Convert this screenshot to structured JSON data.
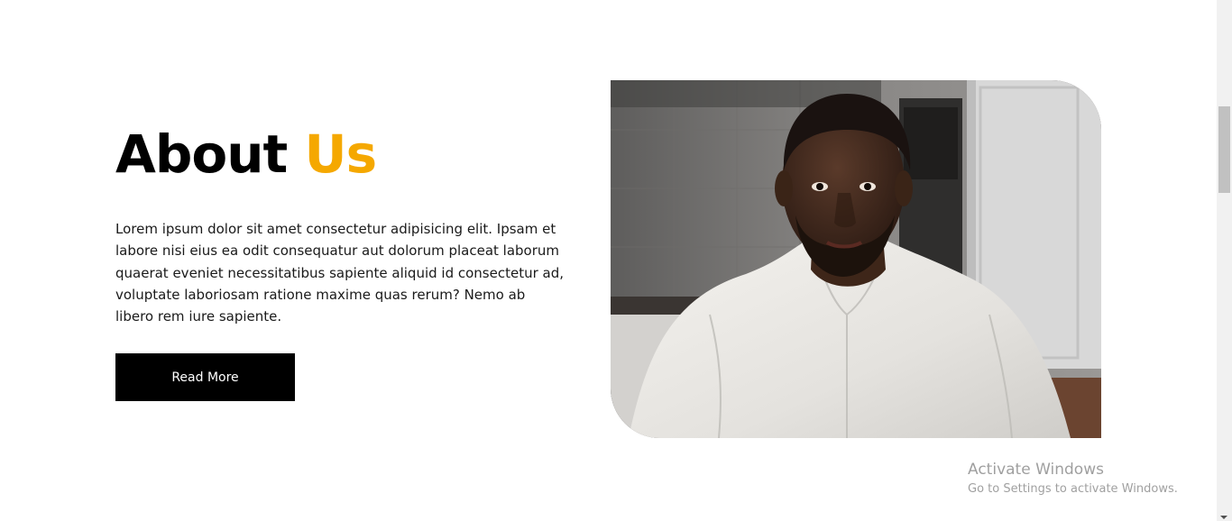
{
  "about": {
    "title_main": "About",
    "title_accent": "Us",
    "description": "Lorem ipsum dolor sit amet consectetur adipisicing elit. Ipsam et labore nisi eius ea odit consequatur aut dolorum placeat laborum quaerat eveniet necessitatibus sapiente aliquid id consectetur ad, voluptate laboriosam ratione maxime quas rerum? Nemo ab libero rem iure sapiente.",
    "button_label": "Read More"
  },
  "watermark": {
    "title": "Activate Windows",
    "subtitle": "Go to Settings to activate Windows."
  },
  "colors": {
    "accent": "#f5a800",
    "text": "#000000",
    "button_bg": "#000000",
    "button_text": "#ffffff"
  }
}
